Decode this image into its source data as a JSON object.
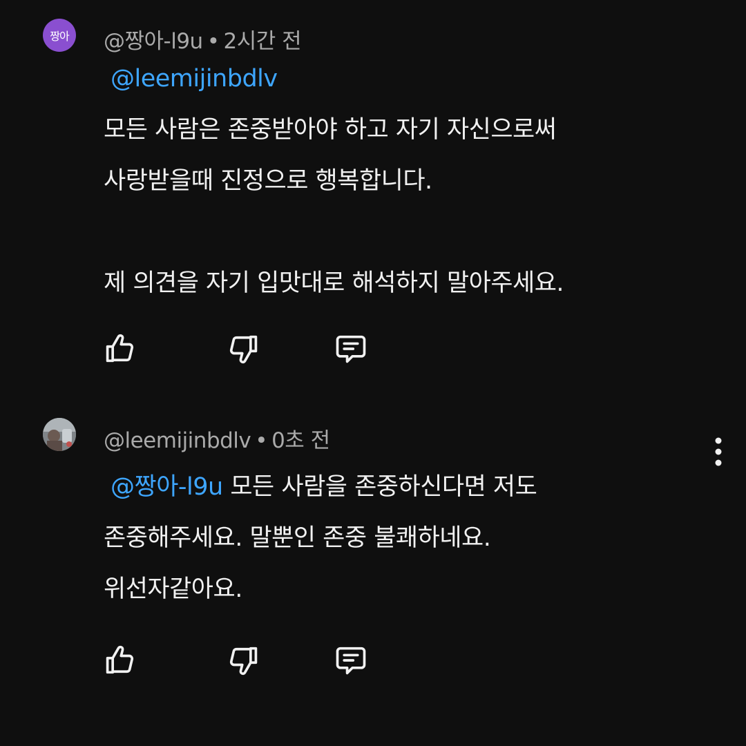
{
  "comments": [
    {
      "avatar_text": "짱아",
      "author": "@짱아-l9u",
      "separator": "•",
      "time": "2시간 전",
      "mention": "@leemijinbdlv",
      "lines": [
        "모든 사람은 존중받아야 하고 자기 자신으로써",
        "사랑받을때 진정으로 행복합니다.",
        "",
        "제 의견을 자기 입맛대로 해석하지 말아주세요."
      ]
    },
    {
      "author": "@leemijinbdlv",
      "separator": "•",
      "time": "0초 전",
      "mention": "@짱아-l9u",
      "first_line_rest": "모든 사람을 존중하신다면 저도",
      "lines": [
        "존중해주세요. 말뿐인 존중 불쾌하네요.",
        "위선자같아요."
      ]
    }
  ],
  "icons": {
    "like": "thumb-up-icon",
    "dislike": "thumb-down-icon",
    "reply": "reply-comment-icon",
    "more": "more-vertical-icon"
  },
  "colors": {
    "background": "#0f0f0f",
    "mention": "#3ea6ff",
    "meta": "#aaaaaa",
    "text": "#f1f1f1",
    "avatar_bg": "#8a4fd0"
  }
}
